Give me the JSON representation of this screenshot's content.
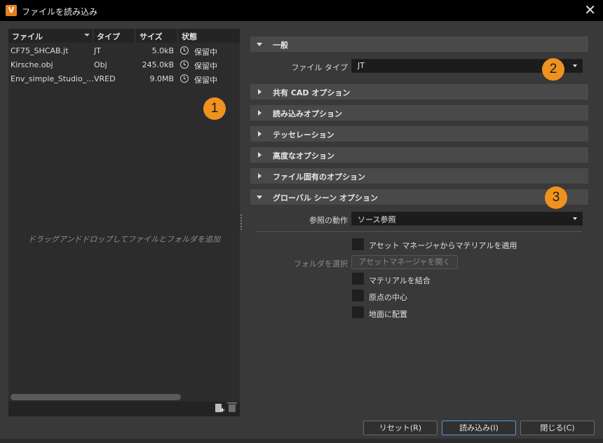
{
  "window": {
    "title": "ファイルを読み込み",
    "app_icon": "V",
    "close_glyph": "✕"
  },
  "file_table": {
    "headers": {
      "file": "ファイル",
      "type": "タイプ",
      "size": "サイズ",
      "status": "状態"
    },
    "rows": [
      {
        "name": "CF75_SHCAB.jt",
        "type": "JT",
        "size": "5.0kB",
        "status": "保留中"
      },
      {
        "name": "Kirsche.obj",
        "type": "Obj",
        "size": "245.0kB",
        "status": "保留中"
      },
      {
        "name": "Env_simple_Studio_...",
        "type": "VRED",
        "size": "9.0MB",
        "status": "保留中"
      }
    ],
    "drop_hint": "ドラッグアンドドロップしてファイルとフォルダを追加"
  },
  "sections": {
    "general": "一般",
    "shared_cad": "共有 CAD オプション",
    "import_options": "読み込みオプション",
    "tessellation": "テッセレーション",
    "advanced": "高度なオプション",
    "file_specific": "ファイル固有のオプション",
    "global_scene": "グローバル シーン オプション"
  },
  "general": {
    "file_type_label": "ファイル タイプ",
    "file_type_value": "JT"
  },
  "global_scene": {
    "reference_label": "参照の動作",
    "reference_value": "ソース参照",
    "apply_materials": "アセット マネージャからマテリアルを適用",
    "folder_label": "フォルダを選択",
    "open_asset_manager": "アセットマネージャを開く",
    "merge_materials": "マテリアルを結合",
    "center_origin": "原点の中心",
    "place_on_ground": "地面に配置"
  },
  "badges": {
    "b1": "1",
    "b2": "2",
    "b3": "3"
  },
  "buttons": {
    "reset": "リセット(R)",
    "import": "読み込み(I)",
    "close": "閉じる(C)"
  },
  "colors": {
    "accent_badge": "#f0921e",
    "primary_border": "#5b9bd5"
  }
}
